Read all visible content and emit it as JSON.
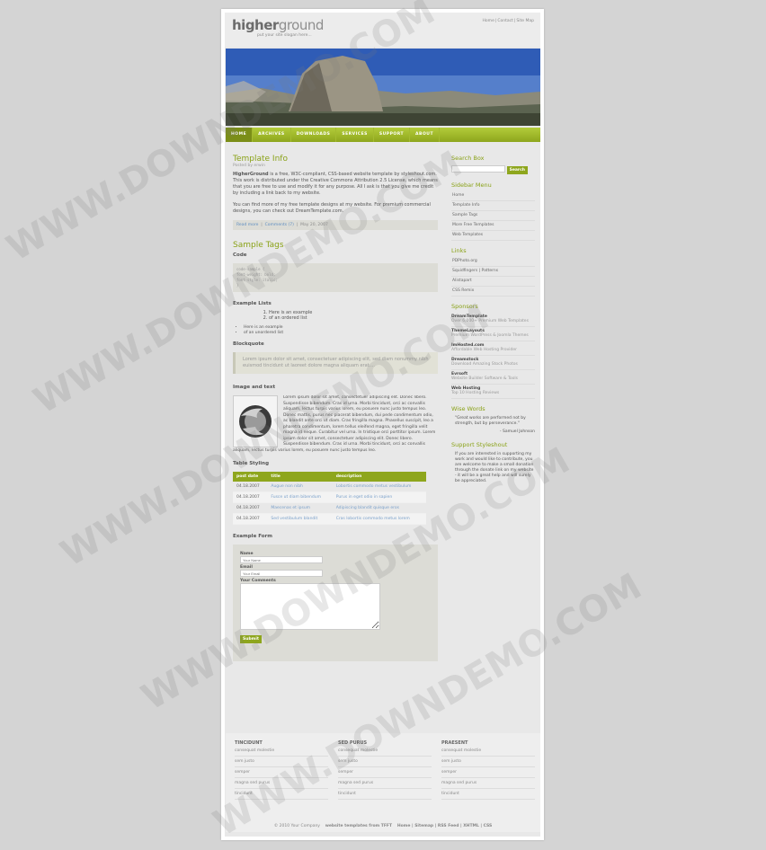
{
  "site": {
    "logo_a": "higher",
    "logo_b": "ground",
    "slogan": "put your site slogan here..."
  },
  "toplinks": [
    "Home",
    "Contact",
    "Site Map"
  ],
  "nav": [
    "HOME",
    "ARCHIVES",
    "DOWNLOADS",
    "SERVICES",
    "SUPPORT",
    "ABOUT"
  ],
  "post": {
    "title": "Template Info",
    "byline": "Posted by erwin",
    "p1_strong": "HigherGround",
    "p1_text": " is a free, W3C-compliant, CSS-based website template by styleshout.com. This work is distributed under the Creative Commons Attribution 2.5 License, which means that you are free to use and modify it for any purpose. All I ask is that you give me credit by including a link back to my website.",
    "p2_text": "You can find more of my free template designs at my website. For premium commercial designs, you can check out DreamTemplate.com.",
    "meta_read": "Read more",
    "meta_comments": "Comments (7)",
    "meta_date": "May 20, 2007"
  },
  "tags": {
    "title": "Sample Tags",
    "code_heading": "Code",
    "code_lines": [
      "code-sample {",
      "  font-weight: bold;",
      "  font-style: italic;",
      "}"
    ],
    "lists_heading": "Example Lists",
    "ordered": [
      "Here is an example",
      "of an ordered list"
    ],
    "unordered": [
      "Here is an example",
      "of an unordered list"
    ],
    "blockquote_heading": "Blockquote",
    "blockquote": "Lorem ipsum dolor sit amet, consectetuer adipiscing elit, sed diam nonummy nibh euismod tincidunt ut laoreet dolore magna aliquam erat....",
    "image_heading": "Image and text",
    "image_text": "Lorem ipsum dolor sit amet, consectetuer adipiscing elit. Donec libero. Suspendisse bibendum. Cras id urna. Morbi tincidunt, orci ac convallis aliquam, lectus turpis varius lorem, eu posuere nunc justo tempus leo. Donec mattis, purus nec placerat bibendum, dui pede condimentum odio, ac blandit ante orci ut diam. Cras fringilla magna. Phasellus suscipit, leo a pharetra condimentum, lorem tellus eleifend magna, eget fringilla velit magna id neque. Curabitur vel urna. In tristique orci porttitor ipsum. Lorem ipsum dolor sit amet, consectetuer adipiscing elit. Donec libero. Suspendisse bibendum. Cras id urna. Morbi tincidunt, orci ac convallis aliquam, lectus turpis varius lorem, eu posuere nunc justo tempus leo.",
    "table_heading": "Table Styling"
  },
  "table": {
    "headers": [
      "post date",
      "title",
      "description"
    ],
    "rows": [
      [
        "04.18.2007",
        "Augue non nibh",
        "Lobortis commodo metus vestibulum"
      ],
      [
        "04.18.2007",
        "Fusce ut diam bibendum",
        "Purus in eget odio in sapien"
      ],
      [
        "04.18.2007",
        "Maecenas et ipsum",
        "Adipiscing blandit quisque eros"
      ],
      [
        "04.18.2007",
        "Sed vestibulum blandit",
        "Cras lobortis commodo metus lorem"
      ]
    ]
  },
  "form": {
    "heading": "Example Form",
    "name_label": "Name",
    "name_placeholder": "Your Name",
    "email_label": "Email",
    "email_placeholder": "Your Email",
    "comments_label": "Your Comments",
    "submit": "Submit"
  },
  "sidebar": {
    "search_title": "Search Box",
    "search_button": "Search",
    "menu_title": "Sidebar Menu",
    "menu": [
      "Home",
      "Template Info",
      "Sample Tags",
      "More Free Templates",
      "Web Templates"
    ],
    "links_title": "Links",
    "links": [
      "PDPhoto.org",
      "Squidfingers | Patterns",
      "Alistapart",
      "CSS Remix"
    ],
    "sponsors_title": "Sponsors",
    "sponsors": [
      {
        "name": "DreamTemplate",
        "desc": "Over 6,000+ Premium Web Templates"
      },
      {
        "name": "ThemeLayouts",
        "desc": "Premium WordPress & Joomla Themes"
      },
      {
        "name": "ImHosted.com",
        "desc": "Affordable Web Hosting Provider"
      },
      {
        "name": "Dreamstock",
        "desc": "Download Amazing Stock Photos"
      },
      {
        "name": "Evrsoft",
        "desc": "Website Builder Software & Tools"
      },
      {
        "name": "Web Hosting",
        "desc": "Top 10 Hosting Reviews"
      }
    ],
    "wise_title": "Wise Words",
    "quote": "\"Great works are performed not by strength, but by perseverance.\"",
    "quote_author": "- Samuel Johnson",
    "support_title": "Support Styleshout",
    "support_text": "If you are interested in supporting my work and would like to contribute, you are welcome to make a small donation through the donate link on my website - it will be a great help and will surely be appreciated."
  },
  "footer": {
    "cols": [
      {
        "title": "TINCIDUNT",
        "items": [
          "consequat molestie",
          "sem justo",
          "semper",
          "magna sed purus",
          "tincidunt"
        ]
      },
      {
        "title": "SED PURUS",
        "items": [
          "consequat molestie",
          "sem justo",
          "semper",
          "magna sed purus",
          "tincidunt"
        ]
      },
      {
        "title": "PRAESENT",
        "items": [
          "consequat molestie",
          "sem justo",
          "semper",
          "magna sed purus",
          "tincidunt"
        ]
      }
    ],
    "copyright": "© 2010 Your Company",
    "credit": "website templates from TFFT",
    "links": "Home | Sitemap | RSS Feed | XHTML | CSS"
  },
  "watermark": "WWW.DOWNDEMO.COM",
  "colors": {
    "accent": "#8ea61d",
    "link": "#5f8ec2"
  }
}
